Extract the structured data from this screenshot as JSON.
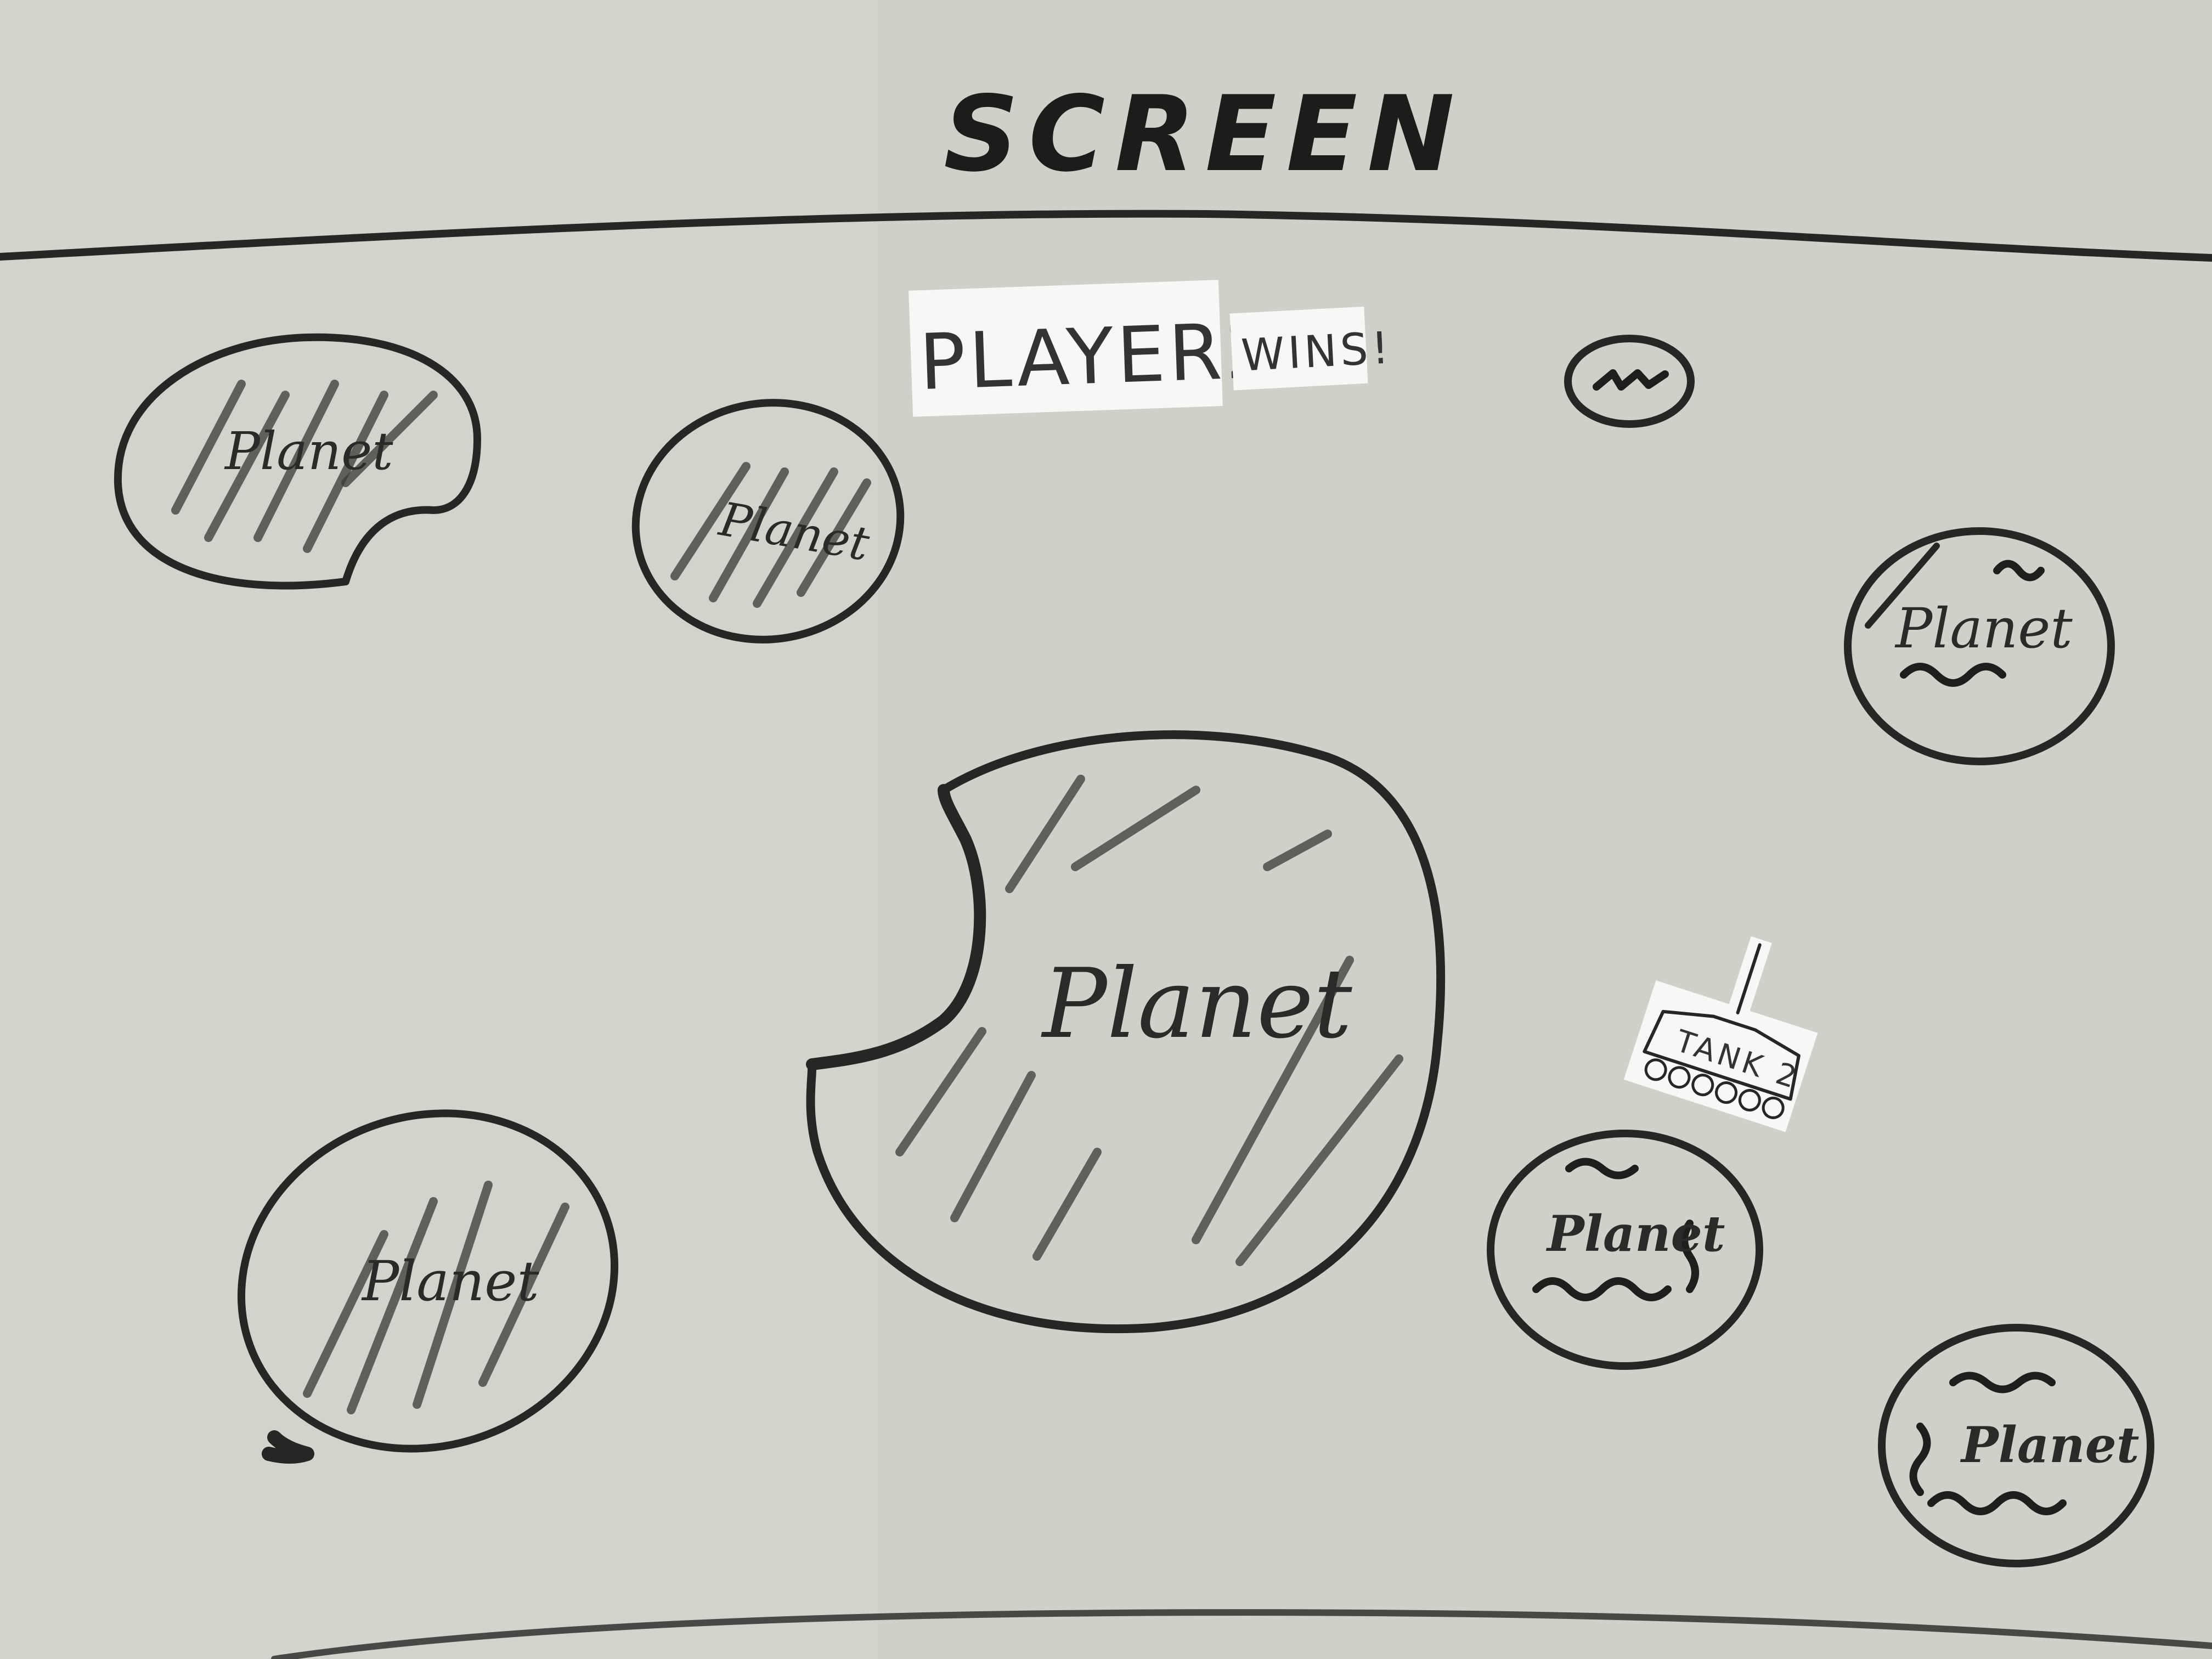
{
  "screen": {
    "title": "SCREEN",
    "colors": {
      "whiteboard": "#cfd1c9",
      "marker": "#262624",
      "paper": "#f7f7f5"
    }
  },
  "game_over": {
    "winner": "PLAYER2",
    "message": "WINS!"
  },
  "tank": {
    "label": "TANK 2",
    "icon": "tank-icon"
  },
  "planets": [
    {
      "label": "Planet",
      "style": "hatched",
      "damaged": true
    },
    {
      "label": "Planet",
      "style": "hatched",
      "damaged": false
    },
    {
      "label": "Planet",
      "style": "wavy",
      "damaged": false
    },
    {
      "label": "Planet",
      "style": "hatched",
      "damaged": true
    },
    {
      "label": "Planet",
      "style": "hatched",
      "damaged": false
    },
    {
      "label": "Planet",
      "style": "wavy",
      "damaged": false
    },
    {
      "label": "Planet",
      "style": "wavy",
      "damaged": false
    }
  ],
  "small_object": {
    "icon": "asteroid-icon"
  }
}
